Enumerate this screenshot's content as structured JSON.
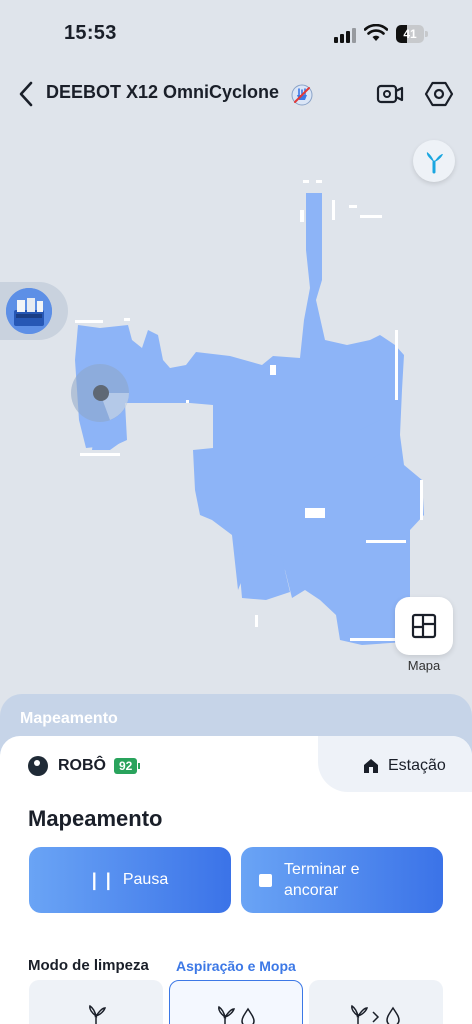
{
  "status_bar": {
    "time": "15:53",
    "battery": "41",
    "battery_level": 0.41
  },
  "header": {
    "title": "DEEBOT X12 OmniCyclone"
  },
  "icons": {
    "back": "chevron-left-icon",
    "mop_off": "no-mop-icon",
    "camera": "video-camera-icon",
    "settings": "hexagon-settings-icon",
    "fan": "fan-icon",
    "map": "floor-plan-icon",
    "home": "home-icon"
  },
  "map": {
    "floor_color": "#8db4f7",
    "background_color": "#dfe4eb"
  },
  "map_button": {
    "label": "Mapa"
  },
  "mapping_strip": {
    "label": "Mapeamento"
  },
  "tabs": {
    "robot": {
      "label": "ROBÔ",
      "battery": "92"
    },
    "station": {
      "label": "Estação"
    }
  },
  "main": {
    "title": "Mapeamento",
    "pause_label": "Pausa",
    "finish_label": "Terminar e ancorar"
  },
  "cleaning_mode": {
    "label": "Modo de limpeza",
    "value": "Aspiração e Mopa",
    "options": [
      "vacuum-icon",
      "vacuum-and-mop-icon",
      "vacuum-then-mop-icon"
    ],
    "selected_index": 1
  },
  "colors": {
    "accent": "#3c78e6",
    "battery_green": "#29a35c"
  }
}
